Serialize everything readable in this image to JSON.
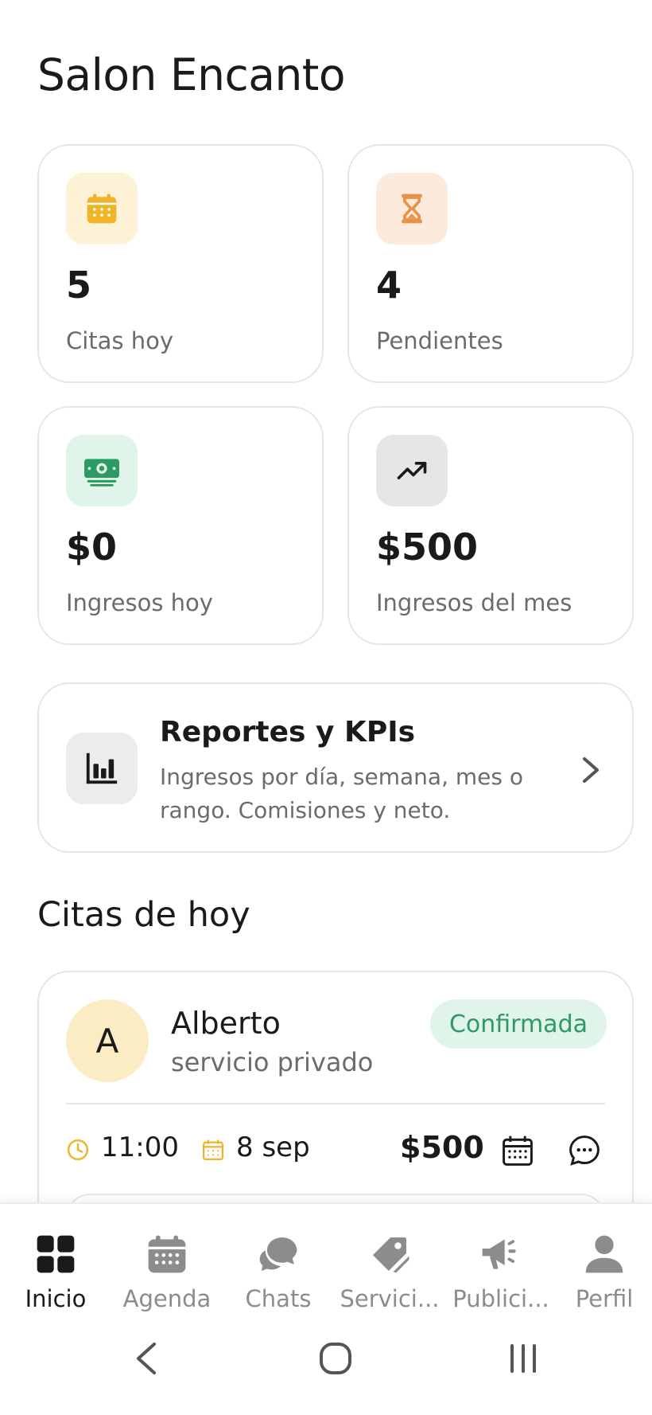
{
  "page": {
    "title": "Salon Encanto"
  },
  "stats": [
    {
      "value": "5",
      "label": "Citas hoy",
      "icon": "calendar-icon",
      "icon_bg": "#fdf2d6",
      "icon_color": "#f0b429"
    },
    {
      "value": "4",
      "label": "Pendientes",
      "icon": "hourglass-icon",
      "icon_bg": "#fcebdc",
      "icon_color": "#e8924a"
    },
    {
      "value": "$0",
      "label": "Ingresos hoy",
      "icon": "money-icon",
      "icon_bg": "#e1f4ea",
      "icon_color": "#2c9a62"
    },
    {
      "value": "$500",
      "label": "Ingresos del mes",
      "icon": "trend-up-icon",
      "icon_bg": "#e6e6e6",
      "icon_color": "#1a1a1a"
    }
  ],
  "report": {
    "title": "Reportes y KPIs",
    "description": "Ingresos por día, semana, mes o rango. Comisiones y neto.",
    "icon": "bar-chart-icon"
  },
  "appointments_section": {
    "title": "Citas de hoy"
  },
  "appointments": [
    {
      "avatar_letter": "A",
      "client": "Alberto",
      "service": "servicio privado",
      "status": "Confirmada",
      "time": "11:00",
      "date": "8 sep",
      "price": "$500"
    }
  ],
  "nav": [
    {
      "label": "Inicio",
      "icon": "grid-icon",
      "active": true
    },
    {
      "label": "Agenda",
      "icon": "calendar-icon",
      "active": false
    },
    {
      "label": "Chats",
      "icon": "chat-bubbles-icon",
      "active": false
    },
    {
      "label": "Servici...",
      "icon": "tag-icon",
      "active": false
    },
    {
      "label": "Publici...",
      "icon": "megaphone-icon",
      "active": false
    },
    {
      "label": "Perfil",
      "icon": "person-icon",
      "active": false
    }
  ],
  "colors": {
    "accent_yellow": "#f0b429",
    "accent_green": "#2c9a62",
    "accent_orange": "#e8924a",
    "muted_text": "#6b6b6b"
  }
}
